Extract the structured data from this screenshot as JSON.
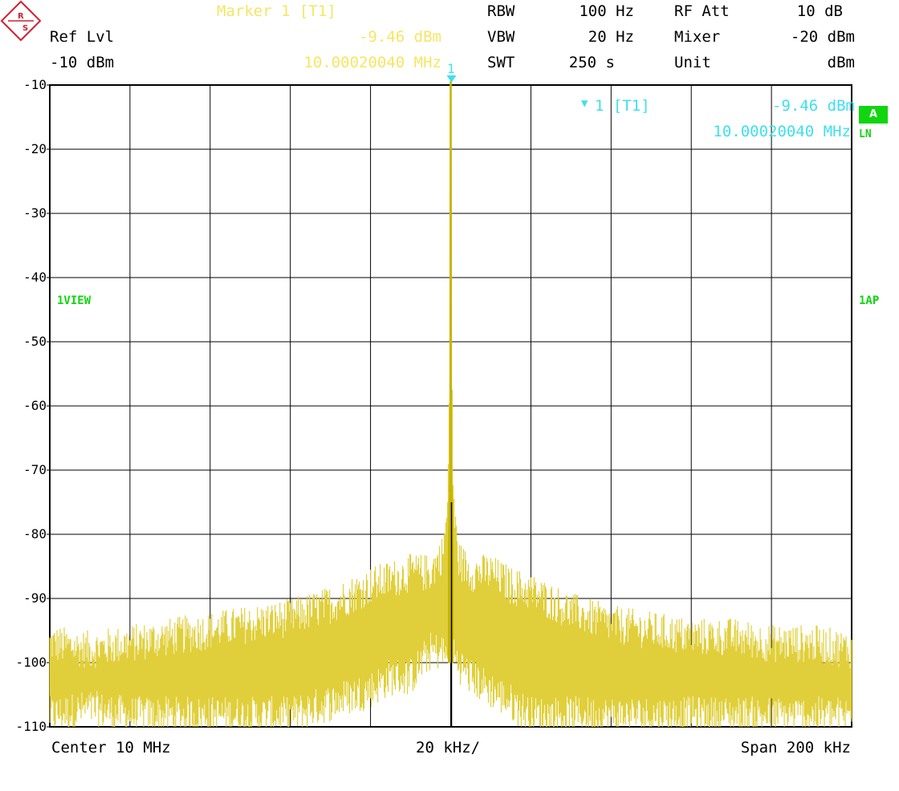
{
  "header": {
    "marker_title": "Marker 1 [T1]",
    "marker_level": "-9.46 dBm",
    "marker_freq": "10.00020040 MHz",
    "ref_lvl_label": "Ref Lvl",
    "ref_lvl_value": "-10 dBm",
    "rbw_label": "RBW",
    "rbw_value": "100 Hz",
    "vbw_label": "VBW",
    "vbw_value": "20 Hz",
    "swt_label": "SWT",
    "swt_value": "250 s",
    "rf_att_label": "RF Att",
    "rf_att_value": "10 dB",
    "mixer_label": "Mixer",
    "mixer_value": "-20 dBm",
    "unit_label": "Unit",
    "unit_value": "dBm"
  },
  "marker_box": {
    "label": "1 [T1]",
    "level": "-9.46 dBm",
    "freq": "10.00020040 MHz",
    "top_number": "1"
  },
  "side": {
    "badge": "A",
    "ln": "LN",
    "view": "1VIEW",
    "ap": "1AP"
  },
  "footer": {
    "center": "Center 10 MHz",
    "div": "20 kHz/",
    "span": "Span 200 kHz"
  },
  "colors": {
    "trace": "#c8b400",
    "trace_fill": "#e0cf3a",
    "marker": "#3fe0ec",
    "accent_green": "#10d610",
    "grid": "#000000"
  },
  "logo_text": "R&S",
  "chart_data": {
    "type": "line",
    "title": "",
    "xlabel": "",
    "ylabel": "",
    "x_unit": "kHz offset from center",
    "xlim": [
      -100,
      100
    ],
    "ylim": [
      -110,
      -10
    ],
    "y_ticks": [
      "-10",
      "-20",
      "-30",
      "-40",
      "-50",
      "-60",
      "-70",
      "-80",
      "-90",
      "-100",
      "-110"
    ],
    "grid": true,
    "series": [
      {
        "name": "",
        "x": [
          -100,
          -90,
          -80,
          -70,
          -60,
          -50,
          -40,
          -30,
          -20,
          -15,
          -10,
          -5,
          -2,
          -1,
          -0.5,
          0,
          0.5,
          1,
          2,
          5,
          10,
          15,
          20,
          30,
          40,
          50,
          60,
          70,
          80,
          90,
          100
        ],
        "y_upper": [
          -97,
          -98,
          -97,
          -96,
          -95,
          -94,
          -93,
          -91,
          -88,
          -87,
          -86,
          -86,
          -83,
          -78,
          -70,
          -9.46,
          -70,
          -78,
          -84,
          -86,
          -86,
          -88,
          -89,
          -92,
          -94,
          -95,
          -96,
          -96,
          -97,
          -97,
          -98
        ],
        "y_lower": [
          -110,
          -109,
          -110,
          -110,
          -110,
          -110,
          -110,
          -108,
          -106,
          -104,
          -104,
          -100,
          -100,
          -101,
          -95,
          -9.46,
          -95,
          -101,
          -102,
          -104,
          -106,
          -108,
          -110,
          -110,
          -110,
          -110,
          -110,
          -110,
          -110,
          -110,
          -110
        ]
      }
    ],
    "marker": {
      "x": 0.2004,
      "y": -9.46
    }
  }
}
